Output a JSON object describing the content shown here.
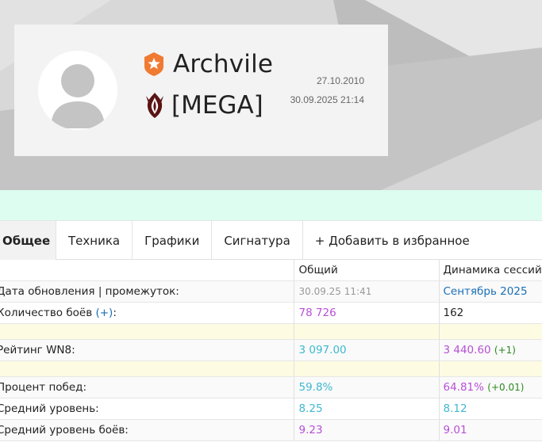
{
  "player": {
    "name": "Archvile",
    "clan_tag": "[MEGA]",
    "registered": "27.10.2010",
    "last_battle": "30.09.2025 21:14"
  },
  "tabs": [
    {
      "label": "Общее",
      "active": true
    },
    {
      "label": "Техника",
      "active": false
    },
    {
      "label": "Графики",
      "active": false
    },
    {
      "label": "Сигнатура",
      "active": false
    },
    {
      "label": "+ Добавить в избранное",
      "active": false
    }
  ],
  "table": {
    "col_overall": "Общий",
    "col_dynamics": "Динамика сессий",
    "rows": {
      "updated": {
        "label": "Дата обновления | промежуток:",
        "overall": "30.09.25 11:41",
        "dynamics": "Сентябрь 2025"
      },
      "battles": {
        "label_prefix": "Количество боёв ",
        "label_link": "(+)",
        "label_suffix": ":",
        "overall": "78 726",
        "dynamics": "162"
      },
      "wn8": {
        "label": "Рейтинг WN8:",
        "overall": "3 097.00",
        "dynamics": "3 440.60",
        "delta": "(+1)"
      },
      "winrate": {
        "label": "Процент побед:",
        "overall": "59.8%",
        "dynamics": "64.81%",
        "delta": "(+0.01)"
      },
      "avg_tier": {
        "label": "Средний уровень:",
        "overall": "8.25",
        "dynamics": "8.12"
      },
      "avg_battle_tier": {
        "label": "Средний уровень боёв:",
        "overall": "9.23",
        "dynamics": "9.01"
      }
    }
  },
  "colors": {
    "mint_band": "#dcfdf0",
    "spacer_row": "#fefbe3",
    "value_purple": "#b84fd6",
    "value_cyan": "#3eb8d0",
    "link_blue": "#1a6fb5",
    "delta_green": "#2b8a1e",
    "badge_orange": "#f07a32",
    "clan_dark_red": "#5a1414"
  },
  "icons": {
    "account_badge": "star-badge-icon",
    "clan_emblem": "clan-emblem-icon",
    "avatar": "default-avatar-icon"
  }
}
